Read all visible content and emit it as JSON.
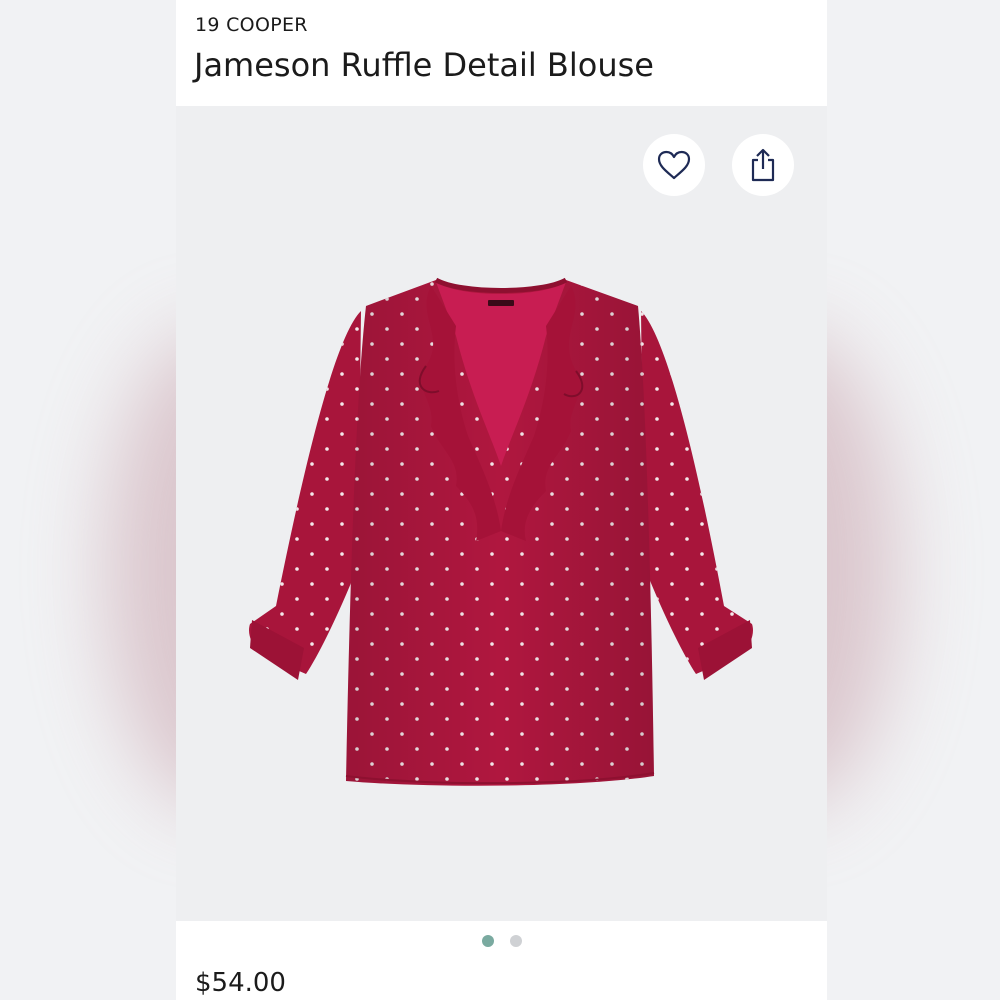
{
  "product": {
    "brand": "19 COOPER",
    "name": "Jameson Ruffle Detail Blouse",
    "price": "$54.00",
    "image_icon": "blouse-image",
    "fabric_color": "#b0173f",
    "print": "white polka dots"
  },
  "actions": {
    "favorite_icon": "heart-icon",
    "share_icon": "share-icon",
    "icon_color": "#1e2a55"
  },
  "carousel": {
    "count": 2,
    "active_index": 0,
    "active_color": "#7aaaa0",
    "inactive_color": "#cfd1d4"
  },
  "colors": {
    "text": "#1b1b1b",
    "image_background": "#eeeff1",
    "backdrop_tint": "#c9a3ad"
  }
}
